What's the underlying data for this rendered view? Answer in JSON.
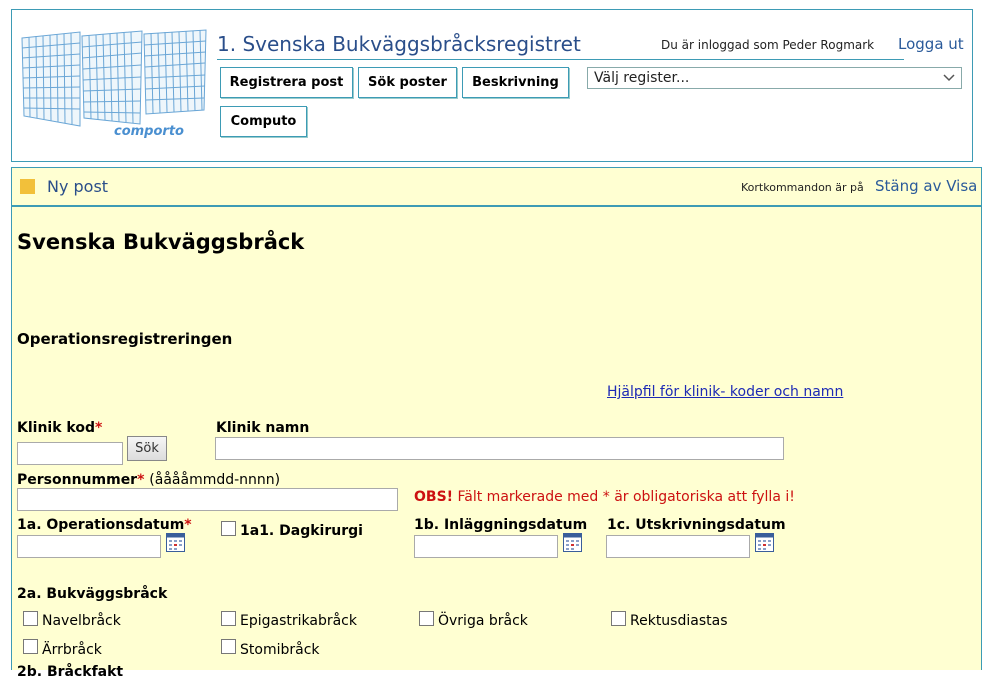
{
  "header": {
    "logo_text": "comporto",
    "title": "1. Svenska Bukväggsbråcksregistret",
    "login_text": "Du är inloggad som Peder Rogmark",
    "logout": "Logga ut",
    "nav": [
      "Registrera post",
      "Sök poster",
      "Beskrivning",
      "Computo"
    ],
    "register_select": "Välj register..."
  },
  "section": {
    "title": "Ny post",
    "shortcut_text": "Kortkommandon är på",
    "shortcut_off": "Stäng av",
    "shortcut_show": "Visa"
  },
  "form": {
    "heading": "Svenska Bukväggsbråck",
    "subheading": "Operationsregistreringen",
    "help_link": "Hjälpfil för klinik- koder och namn",
    "klinik_kod": "Klinik kod",
    "sok": "Sök",
    "klinik_namn": "Klinik namn",
    "personnummer": "Personnummer",
    "personnummer_hint": "(ååååmmdd-nnnn)",
    "obs_prefix": "OBS!",
    "obs_text": "Fält markerade med * är obligatoriska att fylla i!",
    "required_mark": "*",
    "op_datum": "1a. Operationsdatum",
    "dagkirurgi": "1a1. Dagkirurgi",
    "inlagg_datum": "1b. Inläggningsdatum",
    "utskriv_datum": "1c. Utskrivningsdatum",
    "bukvagg_heading": "2a. Bukväggsbråck",
    "bukvagg_options": [
      "Navelbråck",
      "Epigastrikabråck",
      "Övriga bråck",
      "Rektusdiastas",
      "Ärrbråck",
      "Stomibråck"
    ],
    "next_heading_partial": "2b. Bråckfakt"
  },
  "colors": {
    "border": "#3d9bb5",
    "title_blue": "#2a4e8a",
    "form_bg": "#ffffd2",
    "required_red": "#cc1111",
    "link": "#1d2ab5",
    "accent_square": "#f2c03a"
  }
}
